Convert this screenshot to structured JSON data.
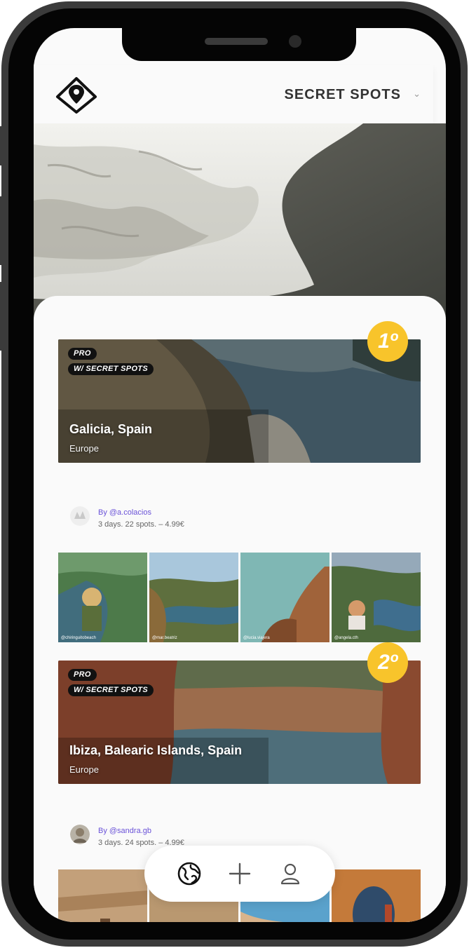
{
  "header": {
    "logo_icon": "map-pin-diamond-icon",
    "title": "SECRET SPOTS",
    "chevron_icon": "chevron-down-icon"
  },
  "hero": {
    "image": "ocean-wave-foam-photo"
  },
  "guides": [
    {
      "rank": "1º",
      "tag_pro": "PRO",
      "tag_secret": "W/ SECRET SPOTS",
      "title": "Galicia, Spain",
      "region": "Europe",
      "author": "By @a.colacios",
      "meta": "3 days. 22 spots. – 4.99€",
      "thumb_captions": [
        "@chiringuitobeach",
        "@mar.beatriz",
        "@lucia.viajera",
        "@angela.cth"
      ]
    },
    {
      "rank": "2º",
      "tag_pro": "PRO",
      "tag_secret": "W/ SECRET SPOTS",
      "title": "Ibiza, Balearic Islands, Spain",
      "region": "Europe",
      "author": "By @sandra.gb",
      "meta": "3 days. 24 spots. – 4.99€",
      "thumb_captions": [
        "",
        "",
        "",
        ""
      ]
    }
  ],
  "nav": {
    "explore_icon": "globe-icon",
    "add_icon": "plus-icon",
    "profile_icon": "user-icon"
  },
  "colors": {
    "accent_rank": "#f8c42b",
    "author_link": "#6a52d8",
    "tag_bg": "#111111"
  }
}
